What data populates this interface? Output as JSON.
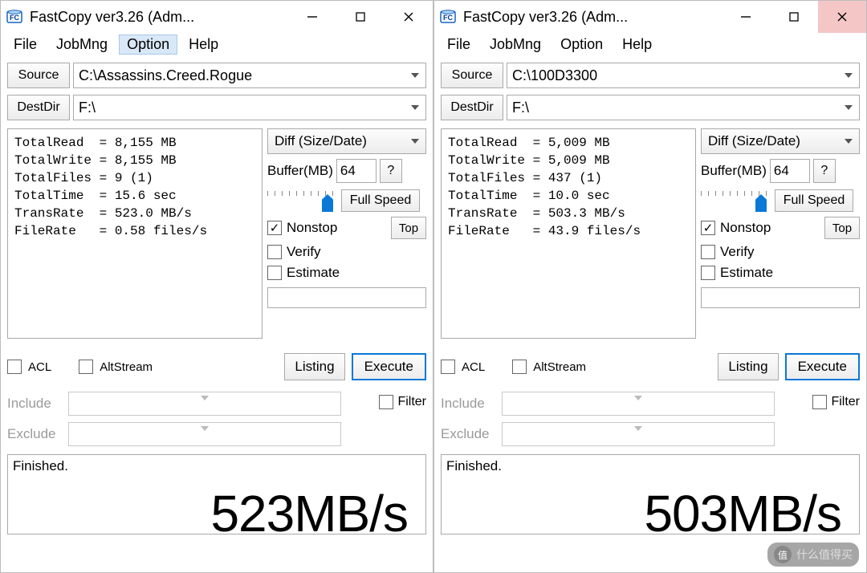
{
  "windows": [
    {
      "title": "FastCopy ver3.26 (Adm...",
      "menu": {
        "file": "File",
        "jobmng": "JobMng",
        "option": "Option",
        "help": "Help",
        "hover": "option"
      },
      "source_label": "Source",
      "source_value": "C:\\Assassins.Creed.Rogue",
      "dest_label": "DestDir",
      "dest_value": "F:\\",
      "stats": "TotalRead  = 8,155 MB\nTotalWrite = 8,155 MB\nTotalFiles = 9 (1)\nTotalTime  = 15.6 sec\nTransRate  = 523.0 MB/s\nFileRate   = 0.58 files/s",
      "mode": "Diff (Size/Date)",
      "buffer_label": "Buffer(MB)",
      "buffer_value": "64",
      "help_q": "?",
      "speed": "Full Speed",
      "nonstop": "Nonstop",
      "nonstop_checked": true,
      "verify": "Verify",
      "verify_checked": false,
      "estimate": "Estimate",
      "estimate_checked": false,
      "top": "Top",
      "acl": "ACL",
      "acl_checked": false,
      "altstream": "AltStream",
      "altstream_checked": false,
      "listing": "Listing",
      "execute": "Execute",
      "include": "Include",
      "exclude": "Exclude",
      "filter": "Filter",
      "filter_checked": false,
      "status": "Finished.",
      "big": "523MB/s",
      "close_hover": false
    },
    {
      "title": "FastCopy ver3.26 (Adm...",
      "menu": {
        "file": "File",
        "jobmng": "JobMng",
        "option": "Option",
        "help": "Help",
        "hover": ""
      },
      "source_label": "Source",
      "source_value": "C:\\100D3300",
      "dest_label": "DestDir",
      "dest_value": "F:\\",
      "stats": "TotalRead  = 5,009 MB\nTotalWrite = 5,009 MB\nTotalFiles = 437 (1)\nTotalTime  = 10.0 sec\nTransRate  = 503.3 MB/s\nFileRate   = 43.9 files/s",
      "mode": "Diff (Size/Date)",
      "buffer_label": "Buffer(MB)",
      "buffer_value": "64",
      "help_q": "?",
      "speed": "Full Speed",
      "nonstop": "Nonstop",
      "nonstop_checked": true,
      "verify": "Verify",
      "verify_checked": false,
      "estimate": "Estimate",
      "estimate_checked": false,
      "top": "Top",
      "acl": "ACL",
      "acl_checked": false,
      "altstream": "AltStream",
      "altstream_checked": false,
      "listing": "Listing",
      "execute": "Execute",
      "include": "Include",
      "exclude": "Exclude",
      "filter": "Filter",
      "filter_checked": false,
      "status": "Finished.",
      "big": "503MB/s",
      "close_hover": true
    }
  ],
  "watermark": "什么值得买"
}
